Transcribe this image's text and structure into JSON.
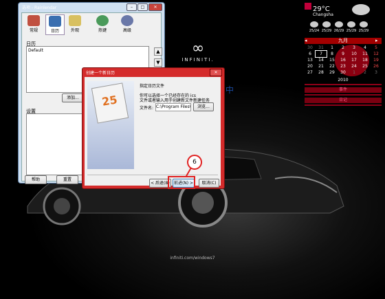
{
  "desktop": {
    "brand_mark": "∞",
    "brand_word": "INFINITI.",
    "brand_url": "infiniti.com/windows7",
    "stray_text": "中"
  },
  "weather": {
    "temp": "29°C",
    "city": "Changsha",
    "days": [
      "25/24",
      "25/29",
      "26/29",
      "25/29",
      "25/29"
    ]
  },
  "calendar": {
    "month": "九月",
    "year": "2010",
    "rows": [
      [
        "30",
        "31",
        "1",
        "2",
        "3",
        "4",
        "5"
      ],
      [
        "6",
        "7",
        "8",
        "9",
        "10",
        "11",
        "12"
      ],
      [
        "13",
        "14",
        "15",
        "16",
        "17",
        "18",
        "19"
      ],
      [
        "20",
        "21",
        "22",
        "23",
        "24",
        "25",
        "26"
      ],
      [
        "27",
        "28",
        "29",
        "30",
        "1",
        "2",
        "3"
      ]
    ],
    "events_label": "事件",
    "notes_label": "日记"
  },
  "main_window": {
    "title": "选项 - Rainlendar",
    "tabs": [
      {
        "label": "常规",
        "icon": "tools-icon"
      },
      {
        "label": "日历",
        "icon": "calendar-icon"
      },
      {
        "label": "外观",
        "icon": "notepad-icon"
      },
      {
        "label": "热键",
        "icon": "globe-icon"
      },
      {
        "label": "高级",
        "icon": "gear-icon"
      }
    ],
    "calendars_label": "日历",
    "calendar_items": [
      "Default"
    ],
    "add_button": "添加...",
    "settings_label": "设置",
    "help_button": "帮助",
    "reset_button": "重置"
  },
  "wizard": {
    "title": "创建一个新日历",
    "heading": "指定日历文件",
    "desc1": "你可以选择一个已经存在的 ics",
    "desc2": "文件或者输入用于创建新文件新建任务",
    "file_label": "文件名:",
    "file_value": "C:\\Program Files\\",
    "browse_button": "浏览...",
    "back_button": "< 后退(B)",
    "next_button": "前进(N) >",
    "cancel_button": "取消(C)",
    "art_number": "25"
  },
  "annotation": {
    "step": "6"
  }
}
